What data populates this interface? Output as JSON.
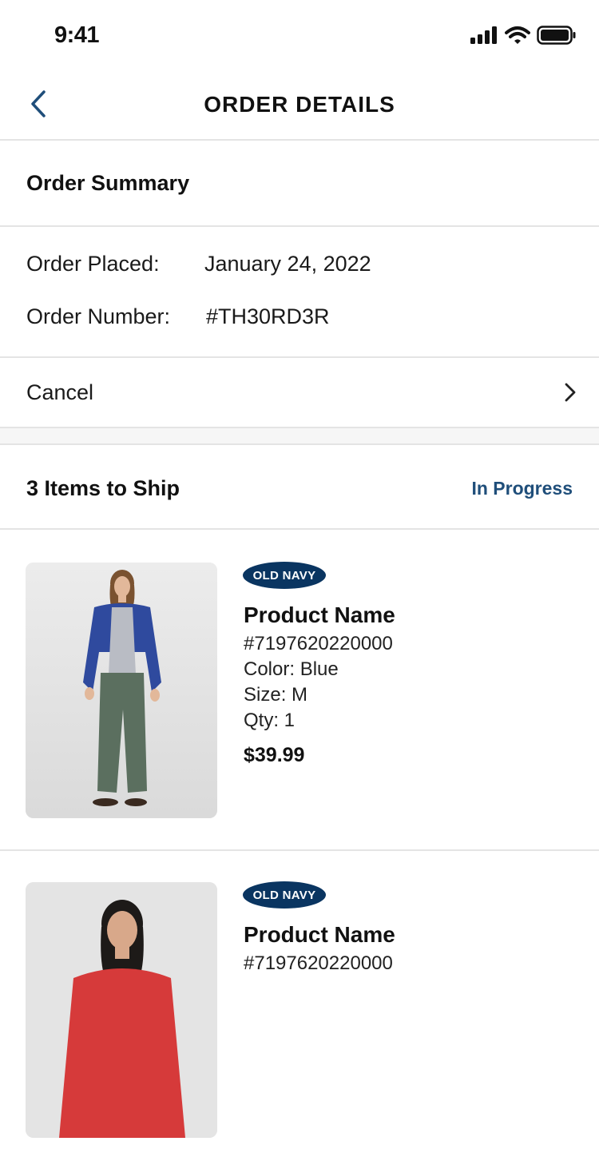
{
  "status_bar": {
    "time": "9:41",
    "icons": [
      "signal-icon",
      "wifi-icon",
      "battery-icon"
    ]
  },
  "nav": {
    "title": "ORDER DETAILS",
    "back_icon": "chevron-left-icon"
  },
  "summary": {
    "heading": "Order Summary",
    "order_placed_label": "Order Placed:",
    "order_placed_value": "January 24, 2022",
    "order_number_label": "Order Number:",
    "order_number_value": "#TH30RD3R"
  },
  "cancel": {
    "label": "Cancel",
    "icon": "chevron-right-icon"
  },
  "shipment": {
    "heading": "3 Items to Ship",
    "status": "In Progress"
  },
  "products": [
    {
      "brand": "OLD NAVY",
      "name": "Product Name",
      "sku": "#7197620220000",
      "color": "Color: Blue",
      "size": "Size: M",
      "qty": "Qty: 1",
      "price": "$39.99"
    },
    {
      "brand": "OLD NAVY",
      "name": "Product Name",
      "sku": "#7197620220000"
    }
  ],
  "colors": {
    "accent": "#1f4e7a",
    "brand_badge": "#0a3561",
    "divider": "#e4e4e4"
  }
}
